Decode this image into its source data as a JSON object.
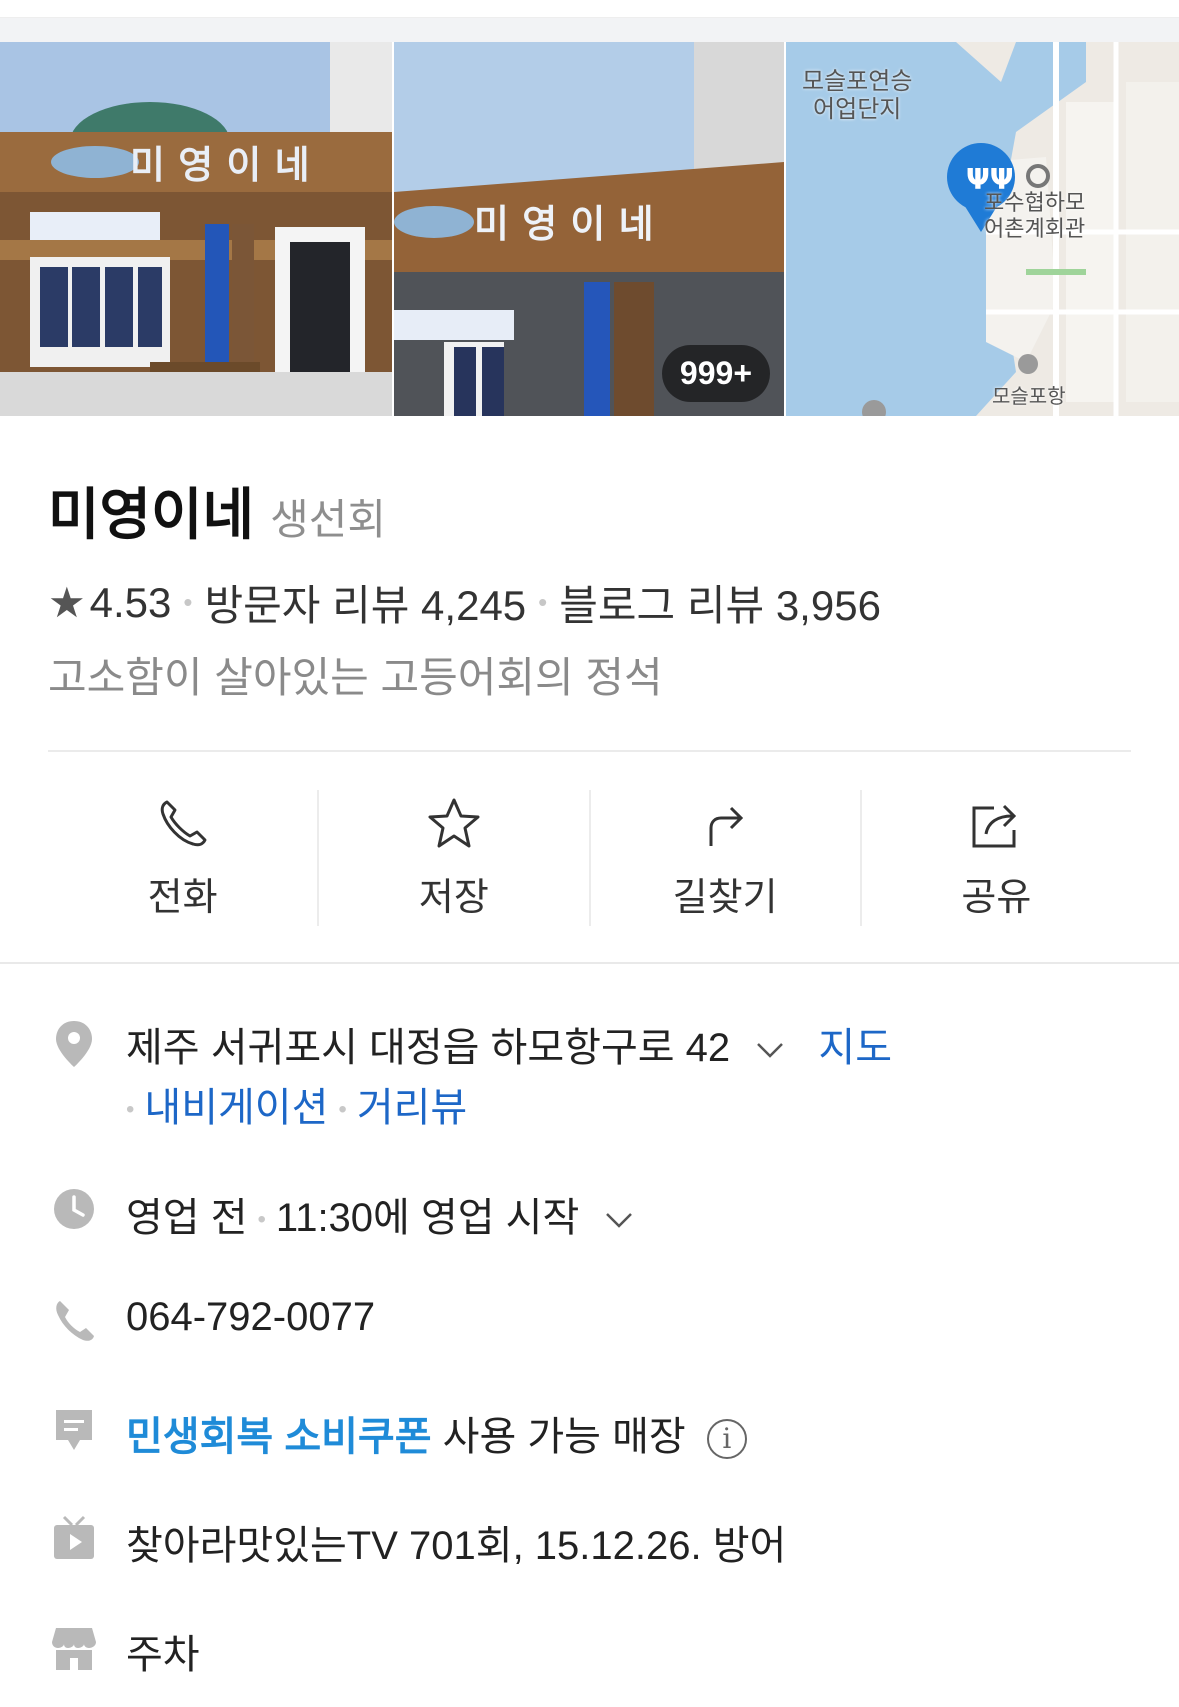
{
  "photos": {
    "count_badge": "999+",
    "map_labels": [
      "모슬포연승\n어업단지",
      "포수협하모\n어촌계회관",
      "모슬포항"
    ],
    "map_labels_line": [
      "모슬포연승",
      "어업단지",
      "포수협하모",
      "어촌계회관",
      "모슬포항"
    ]
  },
  "place": {
    "name": "미영이네",
    "category": "생선회",
    "rating": "4.53",
    "visitor_reviews": "방문자 리뷰 4,245",
    "blog_reviews": "블로그 리뷰 3,956",
    "tagline": "고소함이 살아있는 고등어회의 정석"
  },
  "actions": [
    {
      "label": "전화",
      "icon": "phone-icon"
    },
    {
      "label": "저장",
      "icon": "star-icon"
    },
    {
      "label": "길찾기",
      "icon": "directions-icon"
    },
    {
      "label": "공유",
      "icon": "share-icon"
    }
  ],
  "info": {
    "address": "제주 서귀포시 대정읍 하모항구로 42",
    "map_link": "지도",
    "navi_link": "내비게이션",
    "street_link": "거리뷰",
    "hours_status": "영업 전",
    "hours_detail": "11:30에 영업 시작",
    "phone": "064-792-0077",
    "coupon_strong": "민생회복 소비쿠폰",
    "coupon_rest": "사용 가능 매장",
    "coupon_info": "i",
    "tv": "찾아라맛있는TV 701회, 15.12.26. 방어",
    "parking": "주차"
  },
  "colors": {
    "link": "#1d67c7",
    "coupon": "#1f8bd8",
    "muted": "#8a8a8a",
    "icon_gray": "#b9b9b9"
  }
}
